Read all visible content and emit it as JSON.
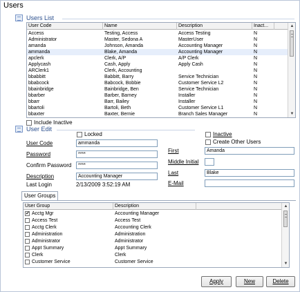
{
  "window": {
    "title": "Users"
  },
  "users_list": {
    "title": "Users List",
    "columns": [
      "User Code",
      "Name",
      "Description",
      "Inact..."
    ],
    "rows": [
      [
        "Access",
        "Testing, Access",
        "Access Testing",
        "N"
      ],
      [
        "Administrator",
        "Master, Sedona A",
        "MasterUser",
        "N"
      ],
      [
        "amanda",
        "Johnson, Amanda",
        "Accounting Manager",
        "N"
      ],
      [
        "ammanda",
        "Blake, Amanda",
        "Accounting Manager",
        "N"
      ],
      [
        "apclerk",
        "Clerk, A/P",
        "A/P Clerk",
        "N"
      ],
      [
        "Applycash",
        "Cash, Apply",
        "Apply Cash",
        "N"
      ],
      [
        "ARClerk1",
        "Clerk, Accounting",
        "",
        "N"
      ],
      [
        "bbabbitt",
        "Babbitt, Barry",
        "Service Technician",
        "N"
      ],
      [
        "bbabcock",
        "Babcock, Bobbie",
        "Customer Service L2",
        "N"
      ],
      [
        "bbainbridge",
        "Bainbridge, Ben",
        "Service Technician",
        "N"
      ],
      [
        "bbarber",
        "Barber, Barney",
        "Installer",
        "N"
      ],
      [
        "bbarr",
        "Barr, Bailey",
        "Installer",
        "N"
      ],
      [
        "bbartoli",
        "Bartoli, Beth",
        "Customer Service L1",
        "N"
      ],
      [
        "bbaxter",
        "Baxter, Bernie",
        "Branch Sales Manager",
        "N"
      ]
    ],
    "selected_row": 3,
    "include_inactive_label": "Include Inactive",
    "include_inactive_checked": false
  },
  "user_edit": {
    "title": "User Edit",
    "locked_label": "Locked",
    "locked_checked": false,
    "inactive_label": "Inactive",
    "inactive_checked": false,
    "create_other_users_label": "Create Other Users",
    "create_other_users_checked": false,
    "user_code_label": "User Code",
    "user_code_value": "ammanda",
    "password_label": "Password",
    "password_value": "****",
    "confirm_password_label": "Confirm Password",
    "confirm_password_value": "****",
    "description_label": "Description",
    "description_value": "Accounting Manager",
    "last_login_label": "Last Login",
    "last_login_value": "2/13/2009 3:52:19 AM",
    "first_label": "First",
    "first_value": "Amanda",
    "middle_initial_label": "Middle Initial",
    "middle_initial_value": "",
    "last_label": "Last",
    "last_value": "Blake",
    "email_label": "E-Mail",
    "email_value": ""
  },
  "user_groups": {
    "tab_label": "User Groups",
    "columns": [
      "User Group",
      "Description"
    ],
    "rows": [
      {
        "group": "Acctg Mgr",
        "description": "Accounting Manager",
        "checked": true
      },
      {
        "group": "Access Test",
        "description": "Access Test",
        "checked": false
      },
      {
        "group": "Acctg Clerk",
        "description": "Accounting Clerk",
        "checked": false
      },
      {
        "group": "Administration",
        "description": "Administration",
        "checked": false
      },
      {
        "group": "Administrator",
        "description": "Administrator",
        "checked": false
      },
      {
        "group": "Appt Summary",
        "description": "Appt Summary",
        "checked": false
      },
      {
        "group": "Clerk",
        "description": "Clerk",
        "checked": false
      },
      {
        "group": "Customer Service",
        "description": "Customer Service",
        "checked": false
      }
    ]
  },
  "buttons": {
    "apply": "Apply",
    "new": "New",
    "delete": "Delete"
  },
  "colors": {
    "section_title": "#2b4f8e",
    "selection": "#e6eefb",
    "border": "#9aa7ba"
  }
}
